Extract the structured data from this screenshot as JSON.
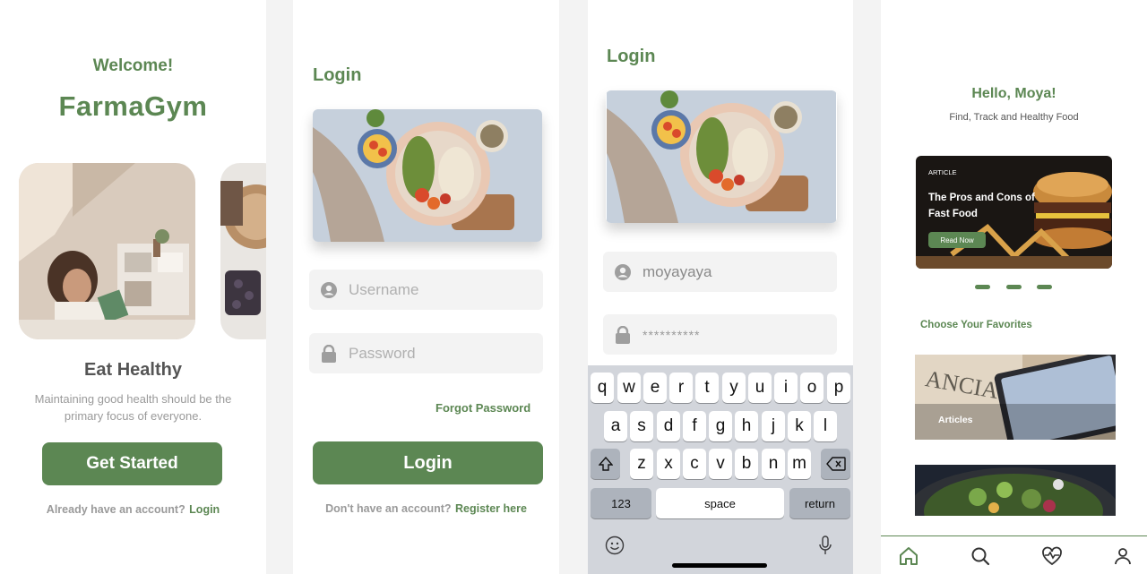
{
  "onboarding": {
    "welcome": "Welcome!",
    "brand": "FarmaGym",
    "title": "Eat Healthy",
    "description": "Maintaining good health should be the primary focus of everyone.",
    "cta": "Get Started",
    "account_prompt": "Already have an account?",
    "login_link": "Login"
  },
  "login_empty": {
    "title": "Login",
    "username_placeholder": "Username",
    "password_placeholder": "Password",
    "forgot": "Forgot Password",
    "button": "Login",
    "register_prompt": "Don't have an account?",
    "register_link": "Register here"
  },
  "login_filled": {
    "title": "Login",
    "username_value": "moyayaya",
    "password_value": "**********",
    "keyboard": {
      "row1": [
        "q",
        "w",
        "e",
        "r",
        "t",
        "y",
        "u",
        "i",
        "o",
        "p"
      ],
      "row2": [
        "a",
        "s",
        "d",
        "f",
        "g",
        "h",
        "j",
        "k",
        "l"
      ],
      "row3": [
        "z",
        "x",
        "c",
        "v",
        "b",
        "n",
        "m"
      ],
      "numbers": "123",
      "space": "space",
      "return": "return"
    }
  },
  "home": {
    "greeting": "Hello, Moya!",
    "subtitle": "Find, Track and Healthy Food",
    "article_tag": "ARTICLE",
    "article_title": "The Pros and Cons of Fast Food",
    "article_button": "Read Now",
    "favorites_title": "Choose Your Favorites",
    "favorite_1": "Articles",
    "tabs": [
      "home-icon",
      "search-icon",
      "heart-pulse-icon",
      "profile-icon"
    ]
  },
  "colors": {
    "brand_green": "#5c8753",
    "field_bg": "#f3f3f3",
    "keyboard_bg": "#d2d5db"
  }
}
